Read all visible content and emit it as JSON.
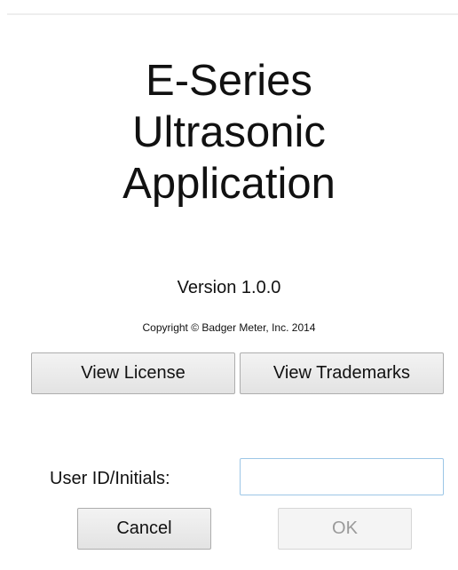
{
  "app": {
    "title_lines": [
      "E-Series",
      "Ultrasonic",
      "Application"
    ],
    "version": "Version 1.0.0",
    "copyright": "Copyright © Badger Meter, Inc. 2014"
  },
  "buttons": {
    "view_license": "View License",
    "view_trademarks": "View Trademarks",
    "cancel": "Cancel",
    "ok": "OK"
  },
  "user_id": {
    "label": "User ID/Initials:",
    "value": "",
    "placeholder": ""
  }
}
